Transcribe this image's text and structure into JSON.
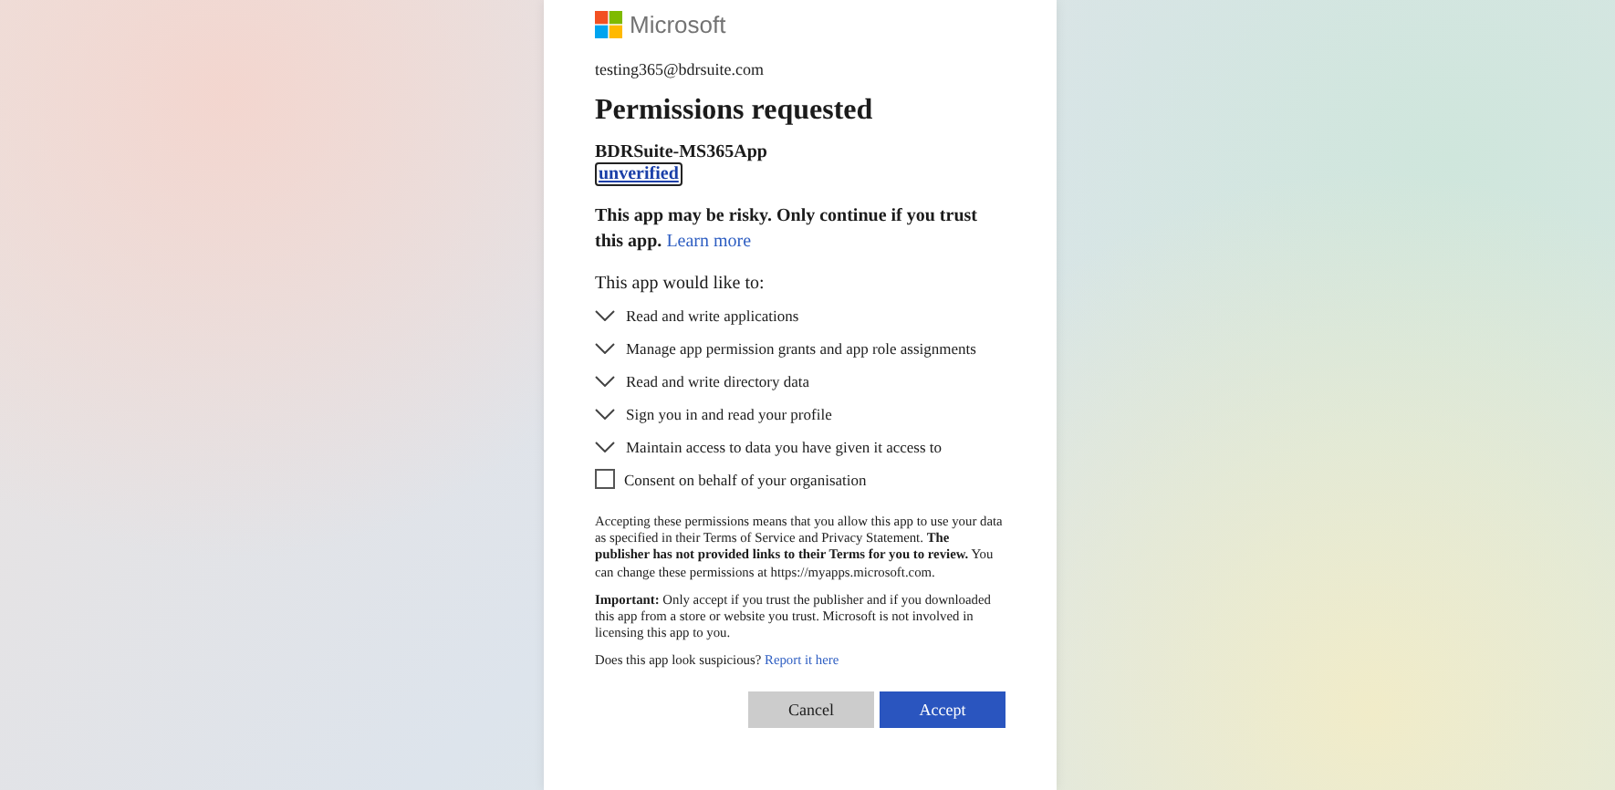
{
  "brand": {
    "name": "Microsoft"
  },
  "account": "testing365@bdrsuite.com",
  "title": "Permissions requested",
  "app": {
    "name": "BDRSuite-MS365App",
    "badge": "unverified"
  },
  "warning": {
    "text": "This app may be risky. Only continue if you trust this app.",
    "link": "Learn more"
  },
  "permissions_heading": "This app would like to:",
  "permissions": [
    {
      "label": "Read and write applications",
      "expanded": false
    },
    {
      "label": "Manage app permission grants and app role assignments",
      "expanded": false
    },
    {
      "label": "Read and write directory data",
      "expanded": false
    },
    {
      "label": "Sign you in and read your profile",
      "expanded": false
    },
    {
      "label": "Maintain access to data you have given it access to",
      "expanded": false
    }
  ],
  "consent": {
    "label": "Consent on behalf of your organisation",
    "checked": false
  },
  "notice": "Accepting these permissions means that you allow this app to use your data as specified in their Terms of Service and Privacy Statement. **The publisher has not provided links to their Terms for you to review.** You can change these permissions at https://myapps.microsoft.com.",
  "important": "**Important:** Only accept if you trust the publisher and if you downloaded this app from a store or website you trust. Microsoft is not involved in licensing this app to you.",
  "suspicious": {
    "text": "Does this app look suspicious?",
    "link": "Report it here"
  },
  "buttons": [
    {
      "label": "Cancel",
      "kind": "secondary"
    },
    {
      "label": "Accept",
      "kind": "primary"
    }
  ]
}
